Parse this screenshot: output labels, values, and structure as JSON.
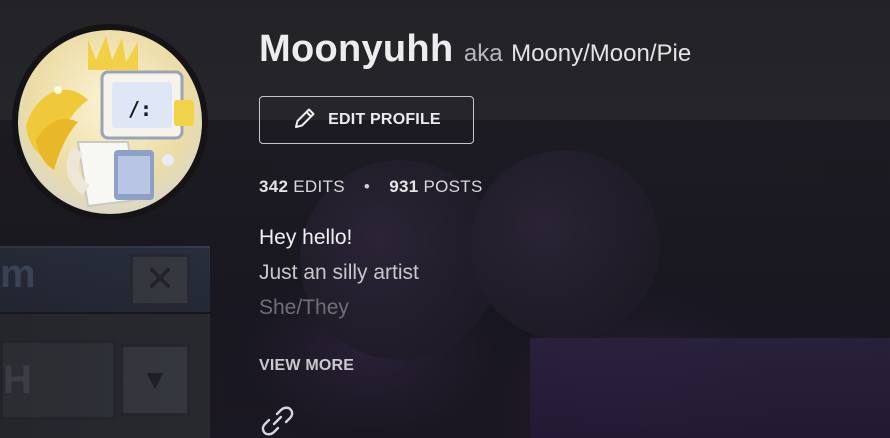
{
  "profile": {
    "username": "Moonyuhh",
    "aka_label": "aka",
    "aka_value": "Moony/Moon/Pie",
    "avatar_icon": "avatar-character-icon"
  },
  "edit_button": {
    "label": "EDIT PROFILE",
    "icon": "pencil-icon"
  },
  "stats": {
    "edits_count": "342",
    "edits_label": "EDITS",
    "separator": "•",
    "posts_count": "931",
    "posts_label": "POSTS"
  },
  "bio": {
    "lines": [
      "Hey hello!",
      "Just an silly artist",
      "She/They"
    ]
  },
  "view_more_label": "VIEW MORE",
  "links": {
    "icon": "link-icon"
  },
  "colors": {
    "background": "#1b1b1f",
    "text_primary": "#ededee",
    "text_secondary": "#c7c7cb",
    "border": "#c8c8cc"
  }
}
